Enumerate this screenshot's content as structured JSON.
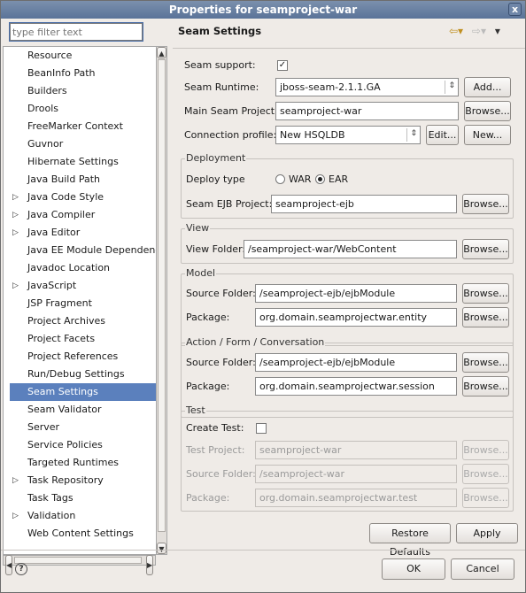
{
  "window": {
    "title": "Properties for seamproject-war",
    "close_glyph": "x"
  },
  "left": {
    "filter_placeholder": "type filter text",
    "items": [
      {
        "label": "Resource",
        "expandable": false
      },
      {
        "label": "BeanInfo Path",
        "expandable": false
      },
      {
        "label": "Builders",
        "expandable": false
      },
      {
        "label": "Drools",
        "expandable": false
      },
      {
        "label": "FreeMarker Context",
        "expandable": false
      },
      {
        "label": "Guvnor",
        "expandable": false
      },
      {
        "label": "Hibernate Settings",
        "expandable": false
      },
      {
        "label": "Java Build Path",
        "expandable": false
      },
      {
        "label": "Java Code Style",
        "expandable": true
      },
      {
        "label": "Java Compiler",
        "expandable": true
      },
      {
        "label": "Java Editor",
        "expandable": true
      },
      {
        "label": "Java EE Module Dependencies",
        "expandable": false
      },
      {
        "label": "Javadoc Location",
        "expandable": false
      },
      {
        "label": "JavaScript",
        "expandable": true
      },
      {
        "label": "JSP Fragment",
        "expandable": false
      },
      {
        "label": "Project Archives",
        "expandable": false
      },
      {
        "label": "Project Facets",
        "expandable": false
      },
      {
        "label": "Project References",
        "expandable": false
      },
      {
        "label": "Run/Debug Settings",
        "expandable": false
      },
      {
        "label": "Seam Settings",
        "expandable": false,
        "selected": true
      },
      {
        "label": "Seam Validator",
        "expandable": false
      },
      {
        "label": "Server",
        "expandable": false
      },
      {
        "label": "Service Policies",
        "expandable": false
      },
      {
        "label": "Targeted Runtimes",
        "expandable": false
      },
      {
        "label": "Task Repository",
        "expandable": true
      },
      {
        "label": "Task Tags",
        "expandable": false
      },
      {
        "label": "Validation",
        "expandable": true
      },
      {
        "label": "Web Content Settings",
        "expandable": false
      }
    ]
  },
  "right": {
    "title": "Seam Settings",
    "seam_support_label": "Seam support:",
    "seam_support_checked": true,
    "runtime_label": "Seam Runtime:",
    "runtime_value": "jboss-seam-2.1.1.GA",
    "add_label": "Add...",
    "main_project_label": "Main Seam Project:",
    "main_project_value": "seamproject-war",
    "browse_label": "Browse...",
    "connection_label": "Connection profile:",
    "connection_value": "New HSQLDB",
    "edit_label": "Edit...",
    "new_label": "New...",
    "deployment": {
      "title": "Deployment",
      "deploy_type_label": "Deploy type",
      "war_label": "WAR",
      "ear_label": "EAR",
      "ejb_label": "Seam EJB Project:",
      "ejb_value": "seamproject-ejb"
    },
    "view": {
      "title": "View",
      "folder_label": "View Folder:",
      "folder_value": "/seamproject-war/WebContent"
    },
    "model": {
      "title": "Model",
      "source_label": "Source Folder:",
      "source_value": "/seamproject-ejb/ejbModule",
      "package_label": "Package:",
      "package_value": "org.domain.seamprojectwar.entity"
    },
    "action": {
      "title": "Action / Form / Conversation",
      "source_label": "Source Folder:",
      "source_value": "/seamproject-ejb/ejbModule",
      "package_label": "Package:",
      "package_value": "org.domain.seamprojectwar.session"
    },
    "test": {
      "title": "Test",
      "create_label": "Create Test:",
      "project_label": "Test Project:",
      "project_value": "seamproject-war",
      "source_label": "Source Folder:",
      "source_value": "/seamproject-war",
      "package_label": "Package:",
      "package_value": "org.domain.seamprojectwar.test"
    },
    "restore_label": "Restore Defaults",
    "apply_label": "Apply"
  },
  "footer": {
    "help_glyph": "?",
    "ok_label": "OK",
    "cancel_label": "Cancel"
  }
}
